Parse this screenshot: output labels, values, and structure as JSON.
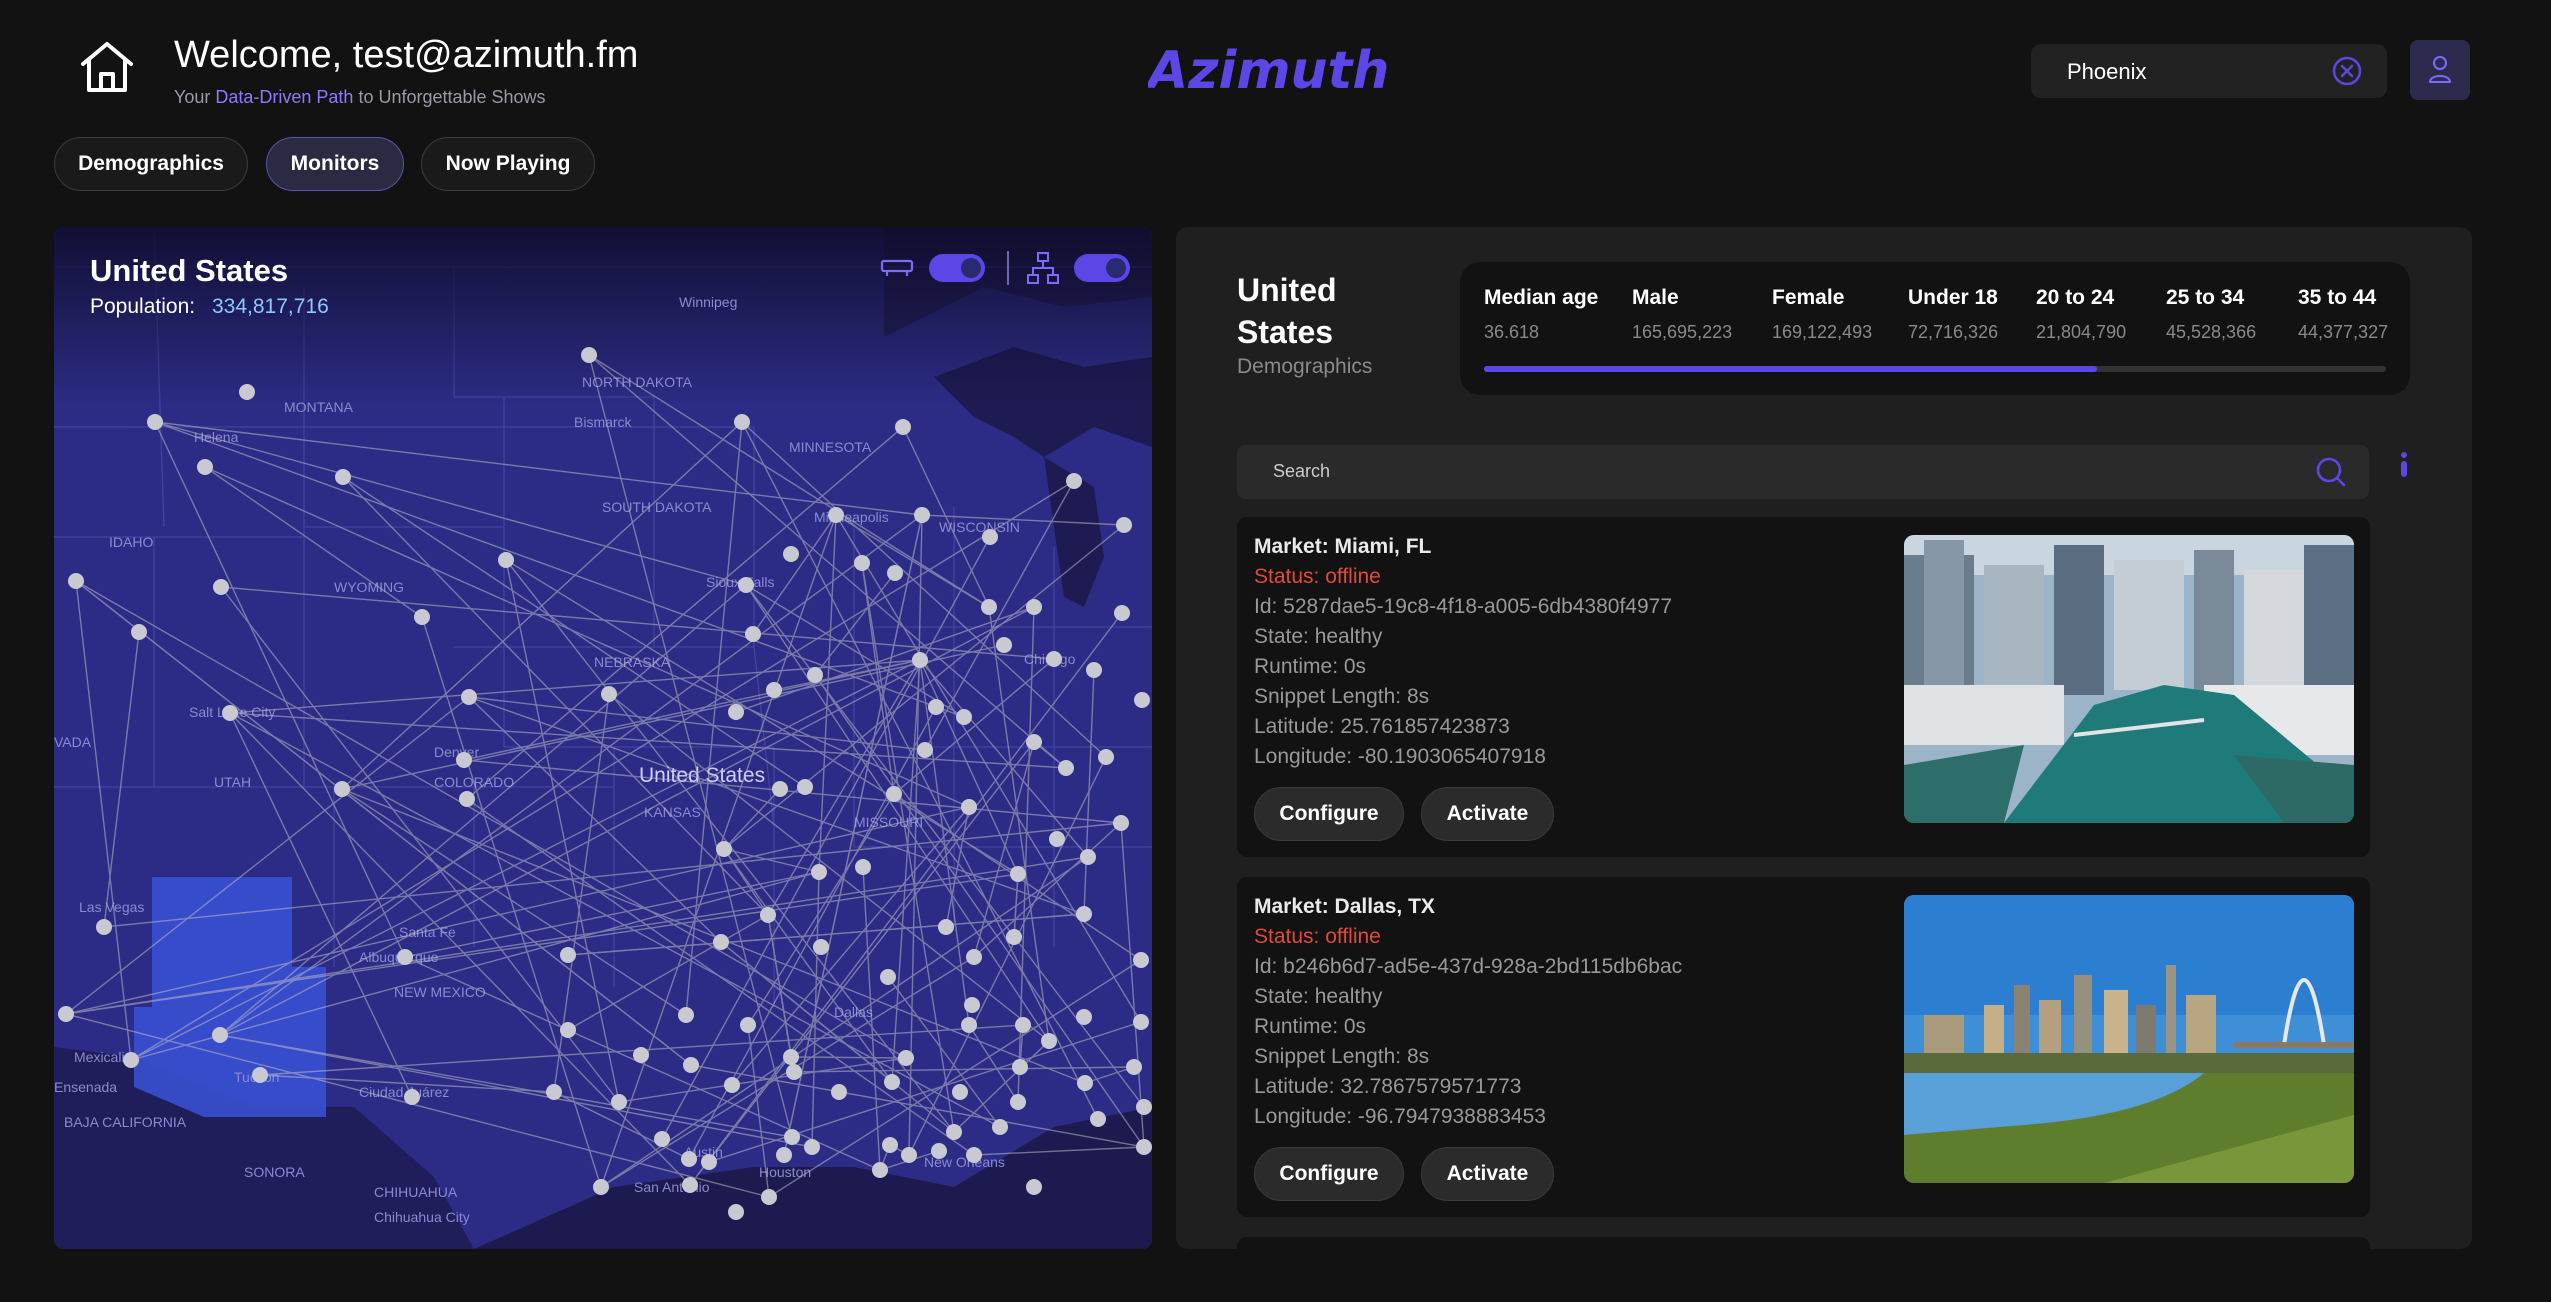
{
  "header": {
    "welcome": "Welcome, test@azimuth.fm",
    "tagline_prefix": "Your ",
    "tagline_accent": "Data-Driven Path",
    "tagline_suffix": " to Unforgettable Shows",
    "logo_text": "Azimuth",
    "city_search_value": "Phoenix",
    "accent_color": "#5b47e6"
  },
  "tabs": [
    {
      "label": "Demographics",
      "active": false
    },
    {
      "label": "Monitors",
      "active": true
    },
    {
      "label": "Now Playing",
      "active": false
    }
  ],
  "map": {
    "title": "United States",
    "population_label": "Population:",
    "population_value": "334,817,716",
    "center_label": "United States",
    "labels": {
      "montana": "MONTANA",
      "north_dakota": "NORTH DAKOTA",
      "bismarck": "Bismarck",
      "minnesota": "MINNESOTA",
      "helena": "Helena",
      "idaho": "IDAHO",
      "wyoming": "WYOMING",
      "south_dakota": "SOUTH DAKOTA",
      "minneapolis": "Minneapolis",
      "wisconsin": "WISCONSIN",
      "sioux_falls": "Sioux Falls",
      "chicago": "Chicago",
      "salt_lake_city": "Salt Lake City",
      "nevada": "VADA",
      "nebraska": "NEBRASKA",
      "utah": "UTAH",
      "denver": "Denver",
      "colorado": "COLORADO",
      "kansas": "KANSAS",
      "missouri": "MISSOURI",
      "las_vegas": "Las Vegas",
      "santa_fe": "Santa Fe",
      "albuquerque": "Albuquerque",
      "new_mexico": "NEW MEXICO",
      "mexicali": "Mexicali",
      "ensenada": "Ensenada",
      "baja": "BAJA CALIFORNIA",
      "tucson": "Tucson",
      "ciudad_juarez": "Ciudad Juárez",
      "sonora": "SONORA",
      "chihuahua": "CHIHUAHUA",
      "chihuahua_city": "Chihuahua City",
      "san_antonio": "San Antonio",
      "houston": "Houston",
      "new_orleans": "New Orleans",
      "austin": "Austin",
      "dallas": "Dallas",
      "winnipeg": "Winnipeg"
    }
  },
  "demographics_panel": {
    "title": "United States",
    "subtitle": "Demographics",
    "columns": [
      {
        "header": "Median age",
        "value": "36.618"
      },
      {
        "header": "Male",
        "value": "165,695,223"
      },
      {
        "header": "Female",
        "value": "169,122,493"
      },
      {
        "header": "Under 18",
        "value": "72,716,326"
      },
      {
        "header": "20 to 24",
        "value": "21,804,790"
      },
      {
        "header": "25 to 34",
        "value": "45,528,366"
      },
      {
        "header": "35 to 44",
        "value": "44,377,327"
      }
    ],
    "scroll_progress": 0.68
  },
  "monitor_list": {
    "search_placeholder": "Search",
    "cards": [
      {
        "market": "Market: Miami, FL",
        "status": "Status: offline",
        "id": "Id: 5287dae5-19c8-4f18-a005-6db4380f4977",
        "state": "State: healthy",
        "runtime": "Runtime: 0s",
        "snippet": "Snippet Length: 8s",
        "latitude": "Latitude: 25.761857423873",
        "longitude": "Longitude: -80.1903065407918",
        "configure": "Configure",
        "activate": "Activate"
      },
      {
        "market": "Market: Dallas, TX",
        "status": "Status: offline",
        "id": "Id: b246b6d7-ad5e-437d-928a-2bd115db6bac",
        "state": "State: healthy",
        "runtime": "Runtime: 0s",
        "snippet": "Snippet Length: 8s",
        "latitude": "Latitude: 32.7867579571773",
        "longitude": "Longitude: -96.7947938883453",
        "configure": "Configure",
        "activate": "Activate"
      }
    ]
  }
}
